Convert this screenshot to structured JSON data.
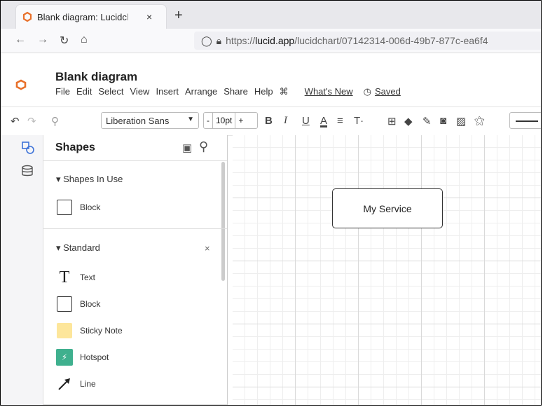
{
  "browser": {
    "tab_title": "Blank diagram: Lucidc",
    "tab_title_fade": "l",
    "tab_close": "×",
    "new_tab": "+",
    "url_prefix": "https://",
    "url_host": "lucid.app",
    "url_path": "/lucidchart/07142314-006d-49b7-877c-ea6f4"
  },
  "app": {
    "doc_title": "Blank diagram",
    "menu": [
      "File",
      "Edit",
      "Select",
      "View",
      "Insert",
      "Arrange",
      "Share",
      "Help"
    ],
    "whats_new": "What's New",
    "saved": "Saved",
    "accent": "#e8702a"
  },
  "toolbar": {
    "font": "Liberation Sans",
    "size_minus": "-",
    "size_value": "10pt",
    "size_plus": "+",
    "bold": "B",
    "italic": "I",
    "underline": "U",
    "color_a": "A",
    "align": "≡",
    "text_opts": "T·"
  },
  "panel": {
    "title": "Shapes",
    "section_in_use": "▾ Shapes In Use",
    "in_use": [
      {
        "label": "Block",
        "icon": "block-icon"
      }
    ],
    "section_standard": "▾ Standard",
    "standard_close": "×",
    "standard": [
      {
        "label": "Text",
        "icon": "text-icon"
      },
      {
        "label": "Block",
        "icon": "block-icon"
      },
      {
        "label": "Sticky Note",
        "icon": "sticky-note-icon"
      },
      {
        "label": "Hotspot",
        "icon": "hotspot-icon"
      },
      {
        "label": "Line",
        "icon": "line-icon"
      }
    ]
  },
  "canvas": {
    "node_label": "My Service"
  }
}
